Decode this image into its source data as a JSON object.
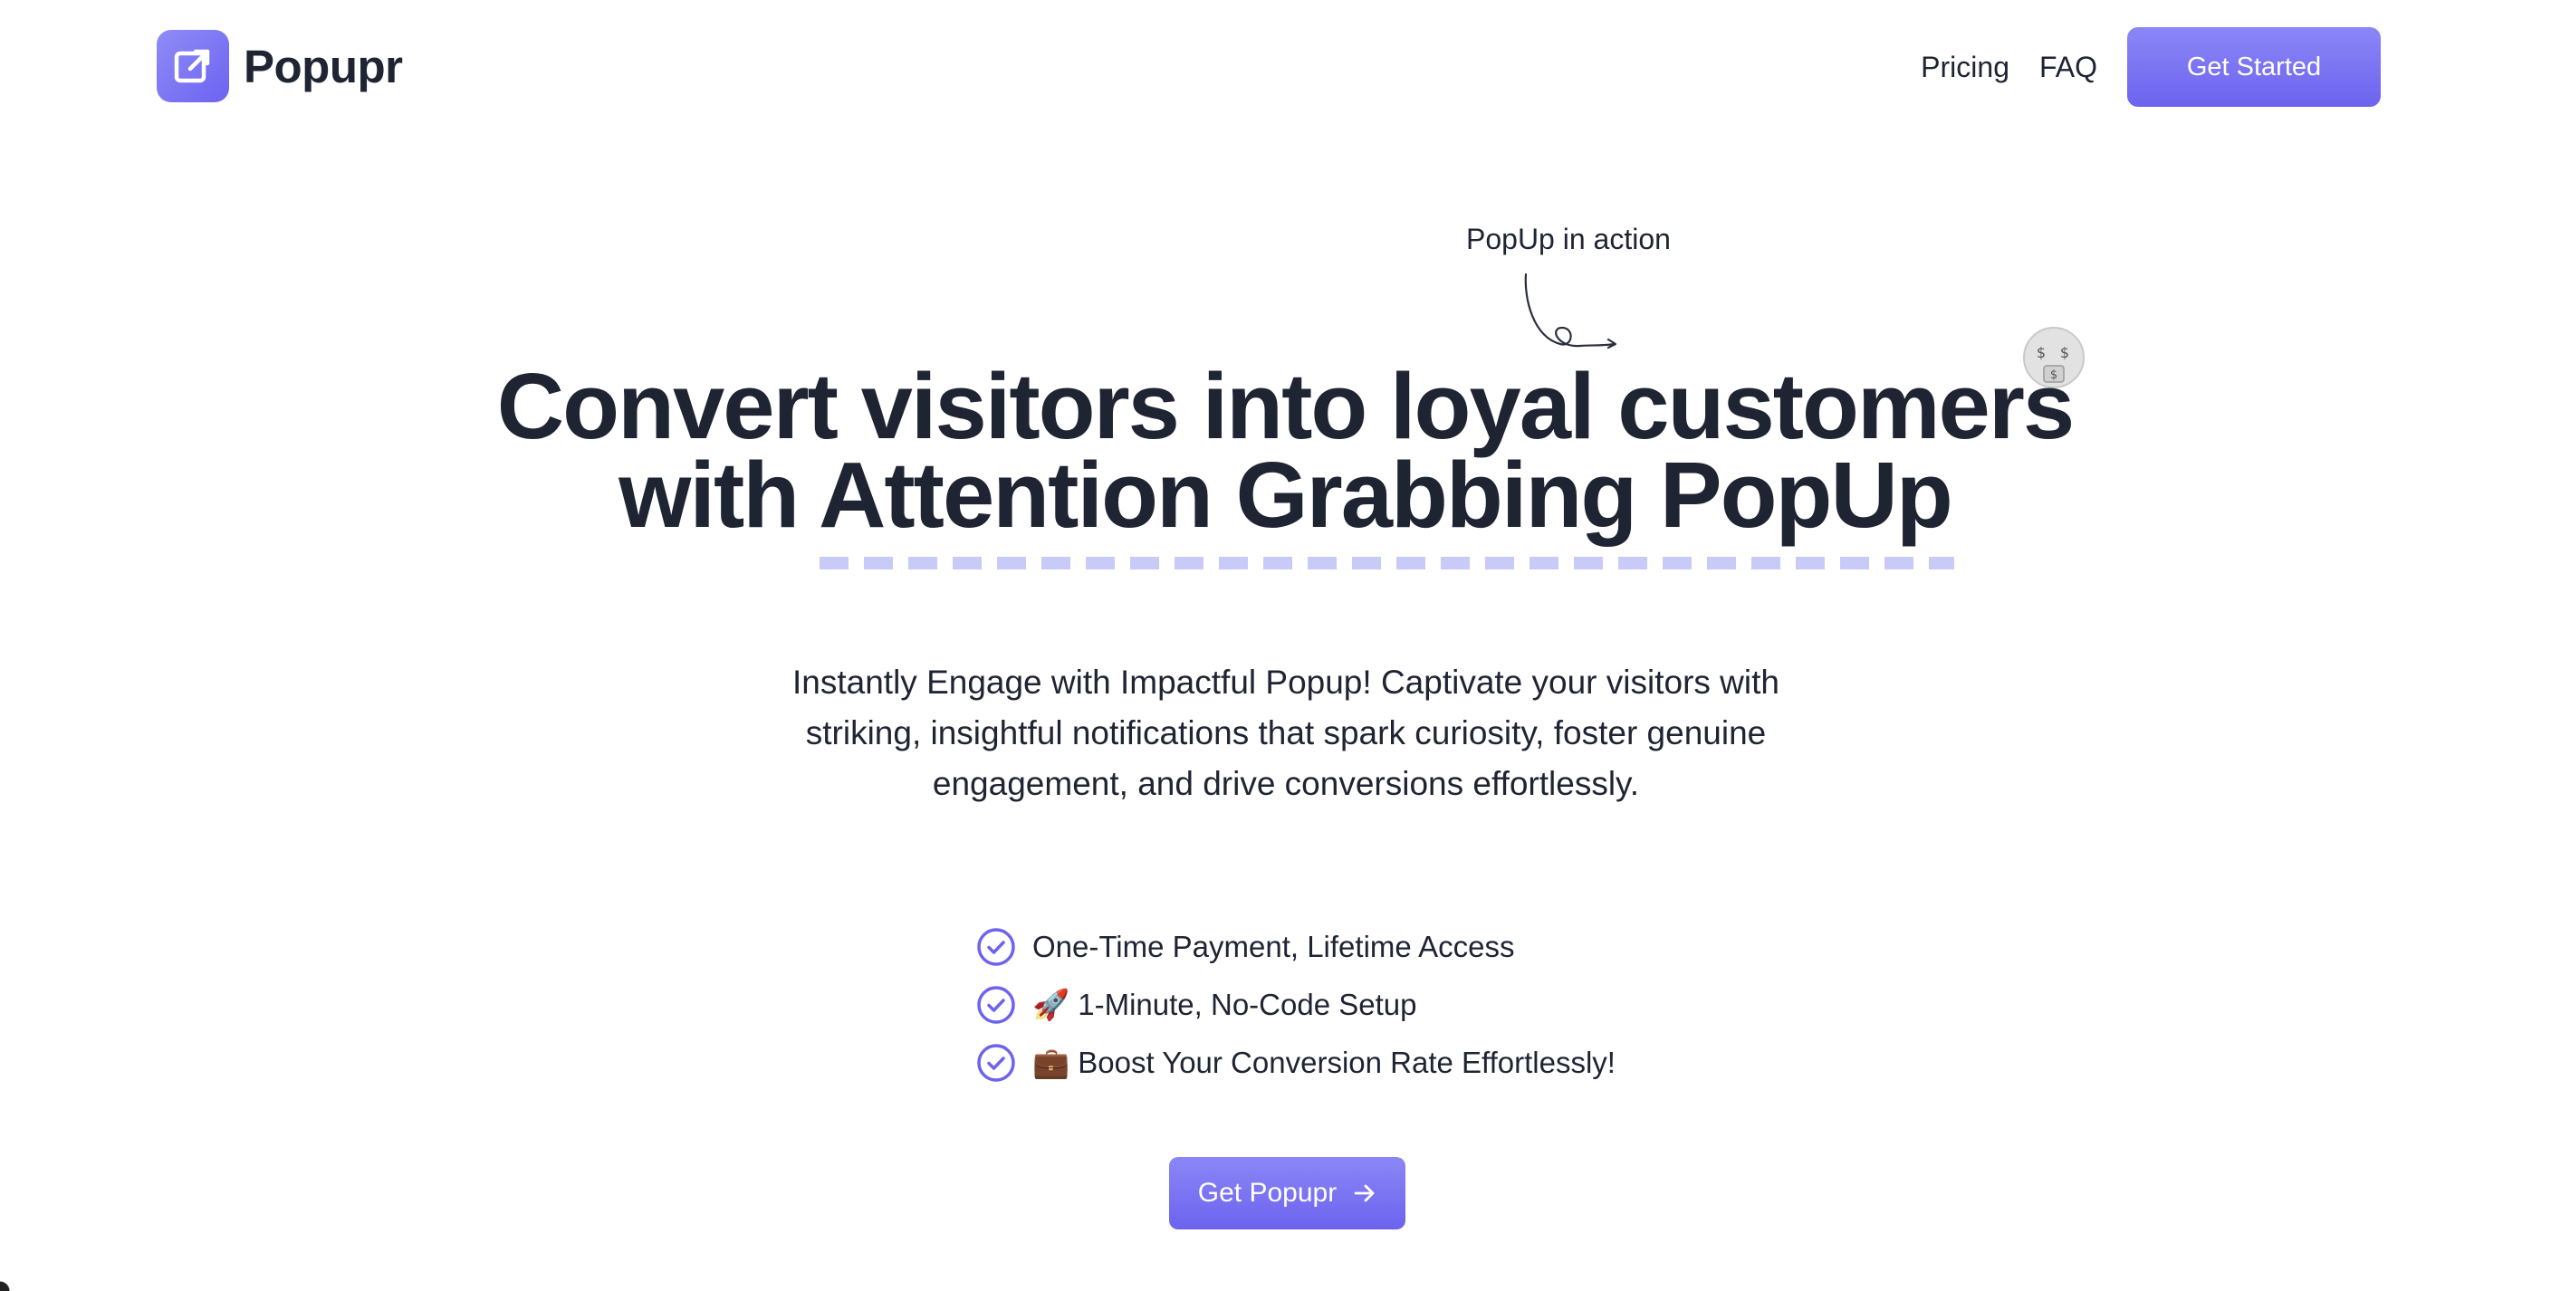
{
  "brand": {
    "name": "Popupr",
    "accent": "#7b73f2"
  },
  "nav": {
    "pricing": "Pricing",
    "faq": "FAQ",
    "cta": "Get Started"
  },
  "hero": {
    "annotation": "PopUp in action",
    "headline_line1": "Convert visitors into loyal customers",
    "headline_line2": "with Attention Grabbing PopUp",
    "subtitle": "Instantly Engage with Impactful Popup! Captivate your visitors with striking, insightful notifications that spark curiosity, foster genuine engagement, and drive conversions effortlessly.",
    "features": [
      "One-Time Payment, Lifetime Access",
      "🚀 1-Minute, No-Code Setup",
      "💼 Boost Your Conversion Rate Effortlessly!"
    ],
    "cta": "Get Popupr",
    "icons": {
      "emoji": "money-mouth-face-icon",
      "check": "check-circle-icon",
      "arrow": "arrow-right-icon"
    }
  }
}
